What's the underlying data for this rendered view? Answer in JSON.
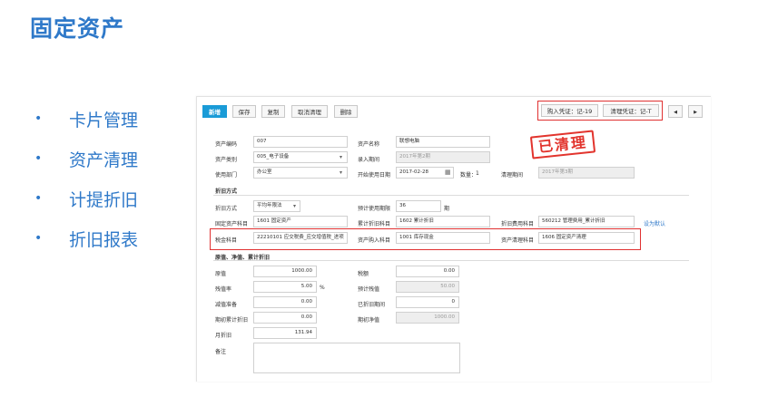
{
  "slide": {
    "title": "固定资产",
    "bullets": [
      "卡片管理",
      "资产清理",
      "计提折旧",
      "折旧报表"
    ]
  },
  "toolbar": {
    "new": "新增",
    "save": "保存",
    "copy": "复制",
    "cancel_clear": "取消清理",
    "delete": "删除",
    "purchase_voucher": "购入凭证：记-19",
    "clear_voucher": "清理凭证：记-T",
    "prev_icon": "◀",
    "next_icon": "▶"
  },
  "stamp": "已清理",
  "form": {
    "asset_code_label": "资产编码",
    "asset_code": "007",
    "asset_name_label": "资产名称",
    "asset_name": "联想电脑",
    "category_label": "资产类别",
    "category": "005_电子设备",
    "entry_period_label": "录入期间",
    "entry_period": "2017年第2期",
    "dept_label": "使用部门",
    "dept": "办公室",
    "start_date_label": "开始使用日期",
    "start_date": "2017-02-28",
    "qty_label": "数量：",
    "qty": "1",
    "clear_period_label": "清理期间",
    "clear_period": "2017年第3期",
    "depr_section": "折旧方式",
    "depr_method_label": "折旧方式",
    "depr_method": "平均年限法",
    "useful_life_label": "预计使用期限",
    "useful_life": "36",
    "useful_life_unit": "期",
    "fixed_acct_label": "固定资产科目",
    "fixed_acct": "1601 固定资产",
    "accum_acct_label": "累计折旧科目",
    "accum_acct": "1602 累计折旧",
    "expense_acct_label": "折旧费用科目",
    "expense_acct": "560212 管理费用_累计折旧",
    "set_default": "设为默认",
    "tax_acct_label": "税金科目",
    "tax_acct": "22210101 应交税费_应交增值税_进项",
    "purchase_acct_label": "资产购入科目",
    "purchase_acct": "1001 库存现金",
    "clear_acct_label": "资产清理科目",
    "clear_acct": "1606 固定资产清理",
    "value_section": "原值、净值、累计折旧",
    "orig_value_label": "原值",
    "orig_value": "1000.00",
    "tax_label": "税额",
    "tax": "0.00",
    "salvage_rate_label": "残值率",
    "salvage_rate": "5.00",
    "pct": "%",
    "salvage_label": "预计残值",
    "salvage": "50.00",
    "impair_label": "减值准备",
    "impair": "0.00",
    "depr_periods_label": "已折旧期间",
    "depr_periods": "0",
    "begin_accum_label": "期初累计折旧",
    "begin_accum": "0.00",
    "begin_net_label": "期初净值",
    "begin_net": "1000.00",
    "monthly_label": "月折旧",
    "monthly": "131.94",
    "memo_label": "备注",
    "memo": ""
  },
  "colors": {
    "accent": "#2f79c9",
    "primary_button": "#1a9bd7",
    "highlight": "#e03131"
  }
}
